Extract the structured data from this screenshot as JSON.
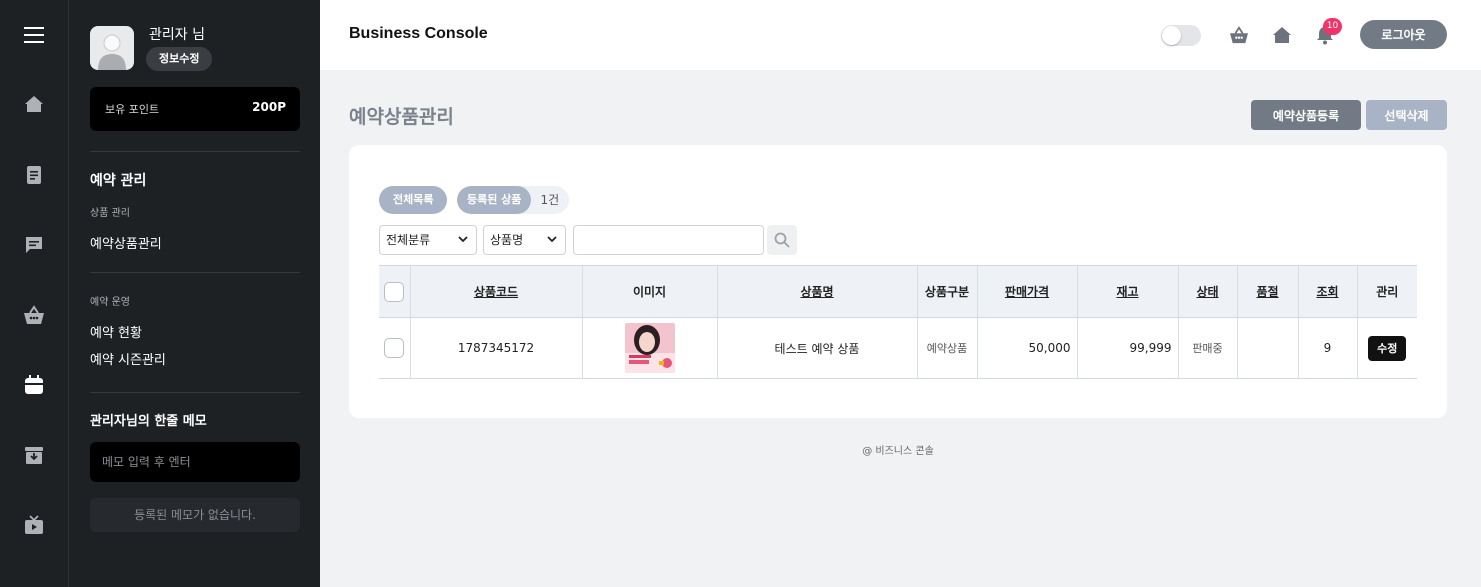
{
  "rail": {
    "icons": [
      "menu-icon",
      "home-icon",
      "document-icon",
      "chat-icon",
      "basket-icon",
      "calendar-icon",
      "archive-icon",
      "tv-icon"
    ],
    "active_color": "#ffffff",
    "inactive_color": "#aeb2b7"
  },
  "profile": {
    "name": "관리자 님",
    "edit_label": "정보수정"
  },
  "points": {
    "label": "보유 포인트",
    "value": "200P"
  },
  "sidebar": {
    "section1_title": "예약 관리",
    "section1_sub": "상품 관리",
    "section1_item": "예약상품관리",
    "section2_sub": "예약 운영",
    "section2_items": [
      "예약 현황",
      "예약 시즌관리"
    ],
    "memo_title": "관리자님의 한줄 메모",
    "memo_placeholder": "메모 입력 후 엔터",
    "memo_empty": "등록된 메모가 없습니다."
  },
  "topbar": {
    "brand": "Business Console",
    "notification_count": "10",
    "logout_label": "로그아웃"
  },
  "page": {
    "title": "예약상품관리",
    "register_label": "예약상품등록",
    "delete_label": "선택삭제"
  },
  "filters": {
    "all_list_label": "전체목록",
    "registered_label": "등록된 상품",
    "registered_count": "1건",
    "category_select": "전체분류",
    "field_select": "상품명",
    "search_value": ""
  },
  "table": {
    "headers": [
      "상품코드",
      "이미지",
      "상품명",
      "상품구분",
      "판매가격",
      "재고",
      "상태",
      "품절",
      "조회",
      "관리"
    ],
    "rows": [
      {
        "code": "1787345172",
        "name": "테스트 예약 상품",
        "type": "예약상품",
        "price": "50,000",
        "stock": "99,999",
        "status": "판매중",
        "soldout": "",
        "views": "9",
        "action": "수정"
      }
    ]
  },
  "footer": {
    "text": "@ 비즈니스 콘솔"
  },
  "colors": {
    "sidebar_bg": "#1e2124",
    "accent_gray": "#727b85",
    "pill_blue_gray": "#a8b3c5",
    "badge_pink": "#f2336a"
  }
}
